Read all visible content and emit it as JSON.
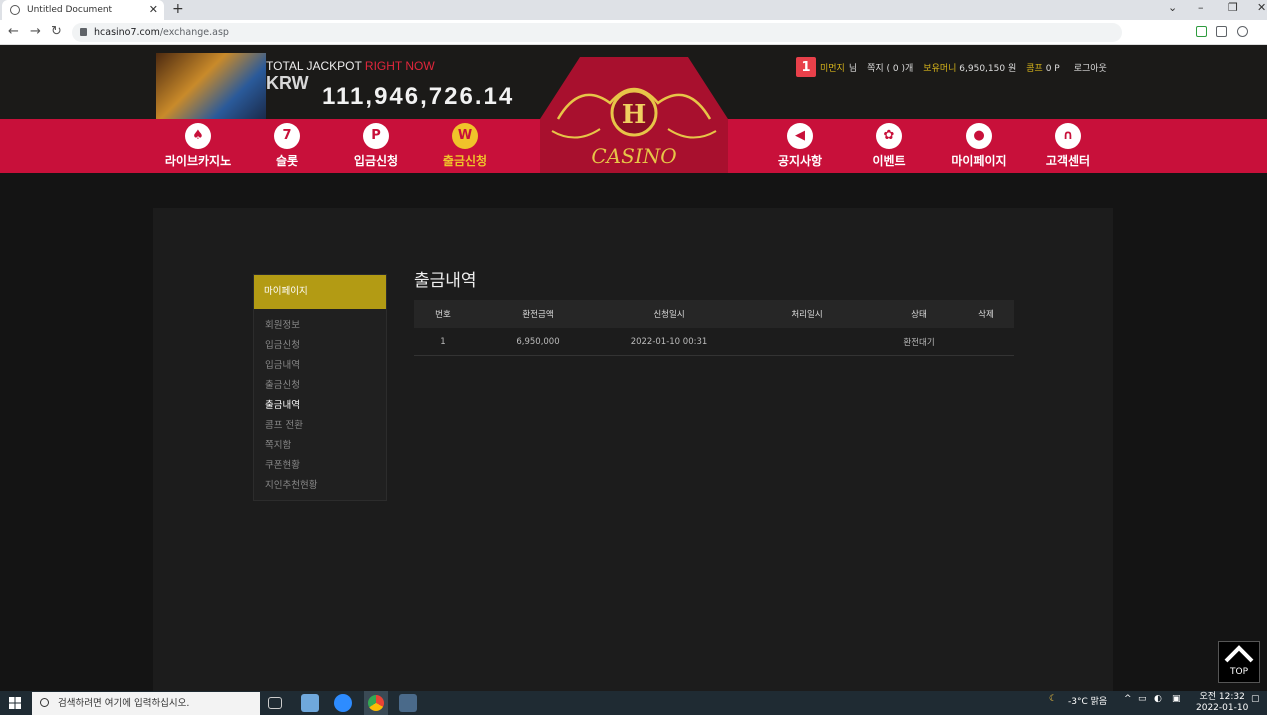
{
  "browser": {
    "tab_title": "Untitled Document",
    "url_domain": "hcasino7.com",
    "url_path": "/exchange.asp"
  },
  "jackpot": {
    "title": "TOTAL JACKPOT",
    "title_highlight": "RIGHT NOW",
    "currency": "KRW",
    "amount": "111,946,726.14"
  },
  "user": {
    "level": "1",
    "name": "미먼지",
    "suffix": "님",
    "messages": "쪽지 ( 0 )개",
    "money_label": "보유머니",
    "money_value": "6,950,150 원",
    "comp_label": "콤프",
    "comp_value": "0 P",
    "logout": "로그아웃"
  },
  "nav": {
    "left": [
      {
        "label": "라이브카지노",
        "icon": "♠"
      },
      {
        "label": "슬롯",
        "icon": "7"
      },
      {
        "label": "입금신청",
        "icon": "P"
      },
      {
        "label": "출금신청",
        "icon": "W"
      }
    ],
    "right": [
      {
        "label": "공지사항",
        "icon": "◀"
      },
      {
        "label": "이벤트",
        "icon": "✿"
      },
      {
        "label": "마이페이지",
        "icon": "●"
      },
      {
        "label": "고객센터",
        "icon": "∩"
      }
    ],
    "logo_letter": "H",
    "logo_text": "CASINO"
  },
  "sidebar": {
    "title": "마이페이지",
    "items": [
      "회원정보",
      "입금신청",
      "입금내역",
      "출금신청",
      "출금내역",
      "콤프 전환",
      "쪽지함",
      "쿠폰현황",
      "지인추천현황"
    ]
  },
  "content": {
    "title": "출금내역",
    "headers": [
      "번호",
      "환전금액",
      "신청일시",
      "처리일시",
      "상태",
      "삭제"
    ],
    "rows": [
      {
        "no": "1",
        "amount": "6,950,000",
        "requested": "2022-01-10 00:31",
        "processed": "",
        "status": "환전대기",
        "delete": ""
      }
    ]
  },
  "top_button": "TOP",
  "taskbar": {
    "search_placeholder": "검색하려면 여기에 입력하십시오.",
    "weather": "-3°C 맑음",
    "time_ampm": "오전 12:32",
    "date": "2022-01-10"
  }
}
